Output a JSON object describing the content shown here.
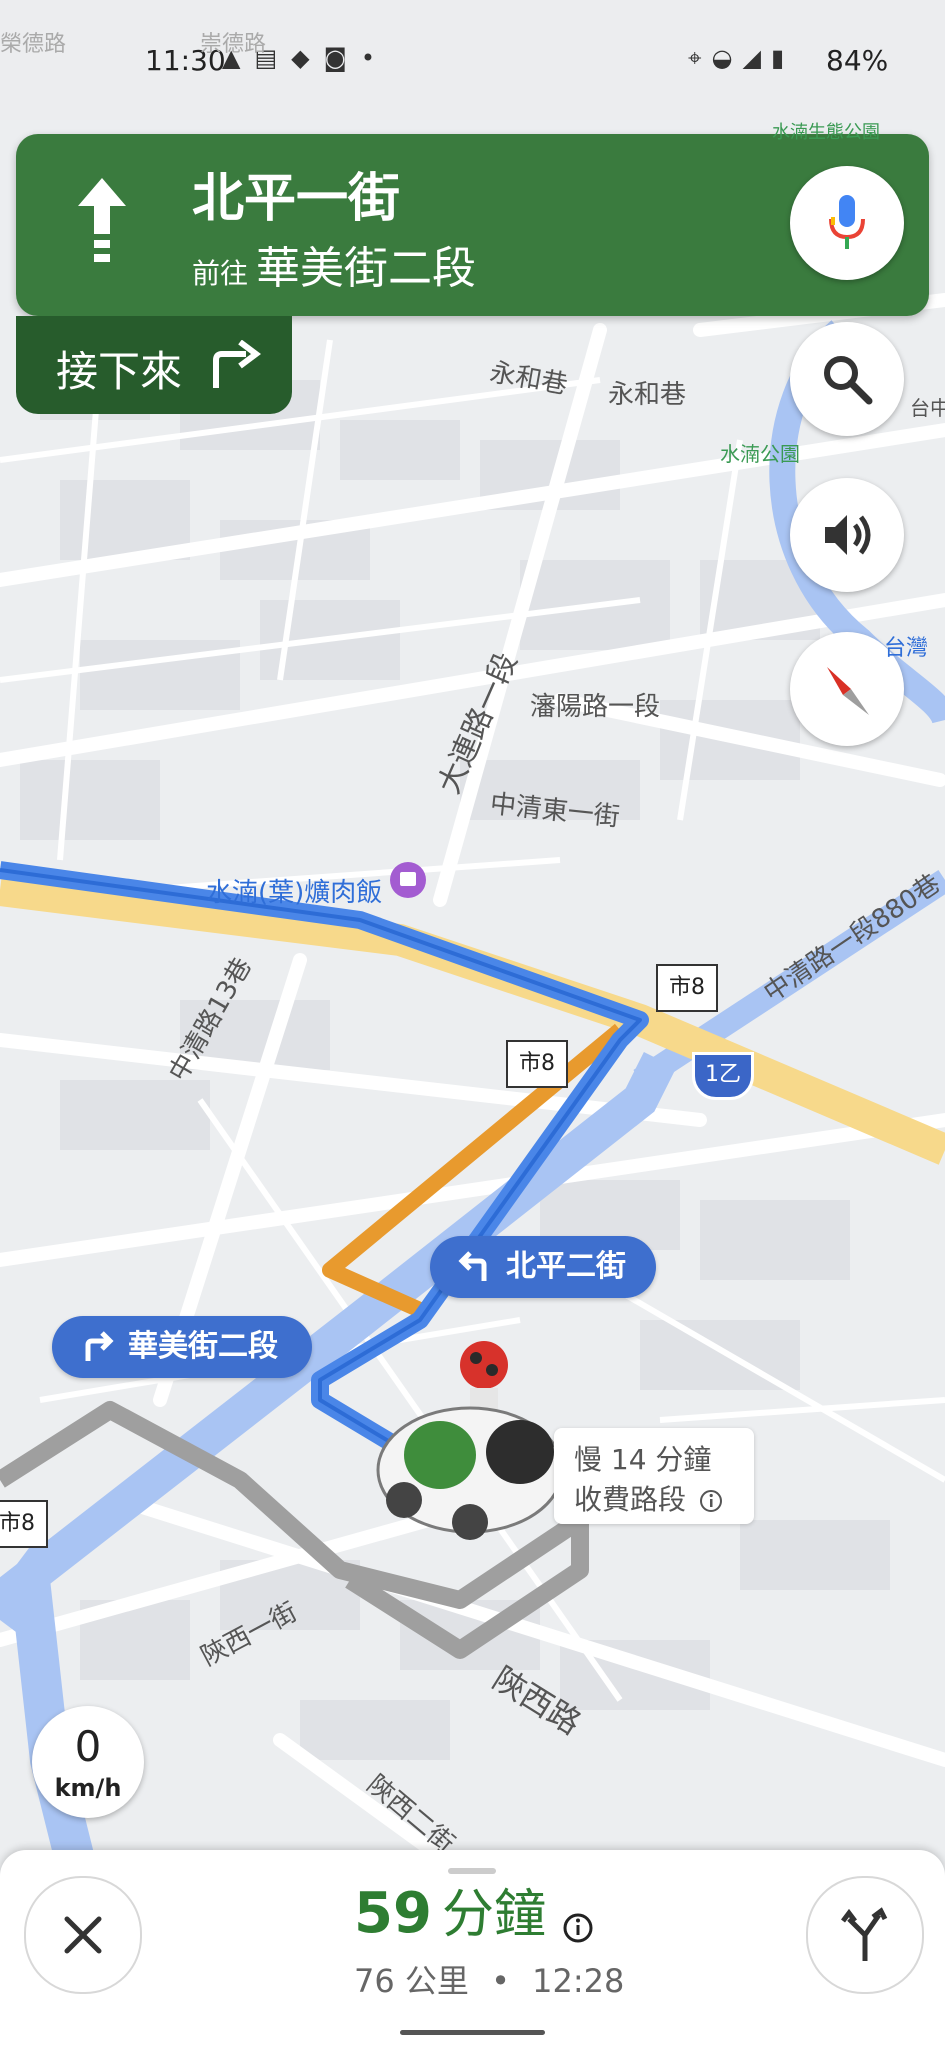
{
  "status_bar": {
    "time": "11:30",
    "left_icons": [
      "navigation-icon",
      "message-icon",
      "app-icon",
      "camera-icon",
      "dot-icon"
    ],
    "right_icons": [
      "location-icon",
      "wifi-icon",
      "signal-icon",
      "battery-icon"
    ],
    "battery": "84%"
  },
  "navigation": {
    "direction_icon": "straight-arrow-icon",
    "street": "北平一街",
    "toward_prefix": "前往",
    "toward_street": "華美街二段",
    "next_label": "接下來",
    "next_icon": "turn-right-icon"
  },
  "map_labels": [
    {
      "text": "永和巷"
    },
    {
      "text": "永和巷"
    },
    {
      "text": "水湳公園"
    },
    {
      "text": "水湳生態公園"
    },
    {
      "text": "大連路一段"
    },
    {
      "text": "瀋陽路一段"
    },
    {
      "text": "中清東一街"
    },
    {
      "text": "水湳(葉)爌肉飯"
    },
    {
      "text": "中清路一段880巷"
    },
    {
      "text": "中清路13巷"
    },
    {
      "text": "陝西一街"
    },
    {
      "text": "陝西路"
    },
    {
      "text": "陝西二街"
    },
    {
      "text": "台灣"
    },
    {
      "text": "台中"
    },
    {
      "text": "榮德路"
    },
    {
      "text": "崇德路"
    }
  ],
  "route_signs": {
    "sign_a": "市8",
    "sign_b": "市8",
    "sign_c": "市8",
    "shield": "1乙"
  },
  "turn_chips": {
    "left": {
      "label": "北平二街",
      "icon": "turn-left-icon"
    },
    "right": {
      "label": "華美街二段",
      "icon": "turn-right-icon"
    }
  },
  "alternate_route": {
    "line1": "慢 14 分鐘",
    "line2": "收費路段"
  },
  "speed": {
    "value": "0",
    "unit": "km/h"
  },
  "trip": {
    "minutes": "59",
    "minutes_unit": "分鐘",
    "distance": "76 公里",
    "separator": "•",
    "arrival": "12:28"
  },
  "colors": {
    "nav_green": "#3a7b3e",
    "next_green": "#275c2c",
    "route_blue": "#4a86e8",
    "eta_green": "#2e7d32",
    "alt_orange": "#f0a030"
  }
}
